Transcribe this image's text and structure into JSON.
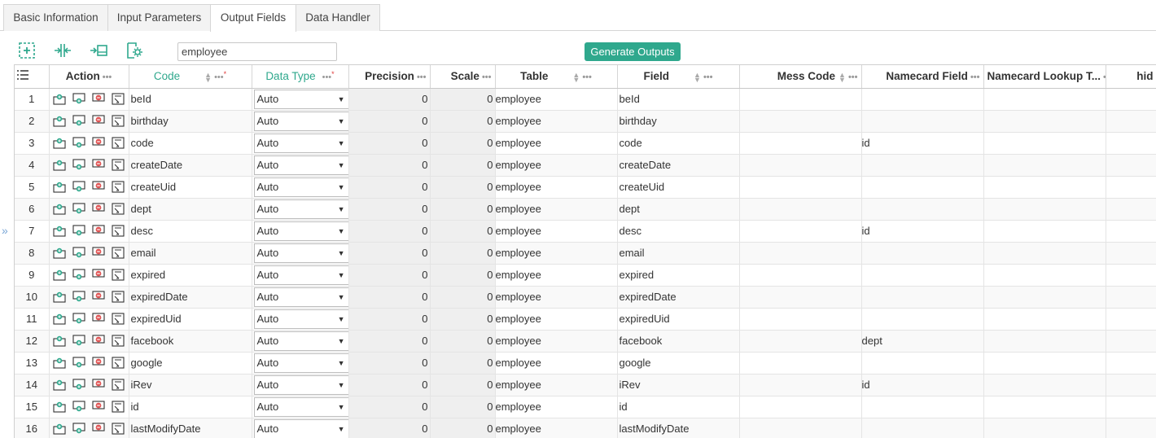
{
  "tabs": [
    {
      "label": "Basic Information"
    },
    {
      "label": "Input Parameters"
    },
    {
      "label": "Output Fields",
      "active": true
    },
    {
      "label": "Data Handler"
    }
  ],
  "toolbar": {
    "icons": [
      "add-frame-icon",
      "split-columns-icon",
      "import-icon",
      "settings-page-icon"
    ],
    "table_name_value": "employee",
    "generate_label": "Generate Outputs"
  },
  "colors": {
    "accent": "#2fa88d",
    "remove": "#e05555"
  },
  "grid": {
    "headers": {
      "action": "Action",
      "code": "Code",
      "data_type": "Data Type",
      "precision": "Precision",
      "scale": "Scale",
      "table": "Table",
      "field": "Field",
      "mess_code": "Mess Code",
      "namecard_field": "Namecard Field",
      "namecard_lookup": "Namecard Lookup T...",
      "hidden_partial": "hid"
    },
    "rows": [
      {
        "n": "1",
        "code": "beId",
        "type": "Auto",
        "precision": "0",
        "scale": "0",
        "table": "employee",
        "field": "beId",
        "namecard": ""
      },
      {
        "n": "2",
        "code": "birthday",
        "type": "Auto",
        "precision": "0",
        "scale": "0",
        "table": "employee",
        "field": "birthday",
        "namecard": ""
      },
      {
        "n": "3",
        "code": "code",
        "type": "Auto",
        "precision": "0",
        "scale": "0",
        "table": "employee",
        "field": "code",
        "namecard": "id"
      },
      {
        "n": "4",
        "code": "createDate",
        "type": "Auto",
        "precision": "0",
        "scale": "0",
        "table": "employee",
        "field": "createDate",
        "namecard": ""
      },
      {
        "n": "5",
        "code": "createUid",
        "type": "Auto",
        "precision": "0",
        "scale": "0",
        "table": "employee",
        "field": "createUid",
        "namecard": ""
      },
      {
        "n": "6",
        "code": "dept",
        "type": "Auto",
        "precision": "0",
        "scale": "0",
        "table": "employee",
        "field": "dept",
        "namecard": ""
      },
      {
        "n": "7",
        "code": "desc",
        "type": "Auto",
        "precision": "0",
        "scale": "0",
        "table": "employee",
        "field": "desc",
        "namecard": "id"
      },
      {
        "n": "8",
        "code": "email",
        "type": "Auto",
        "precision": "0",
        "scale": "0",
        "table": "employee",
        "field": "email",
        "namecard": ""
      },
      {
        "n": "9",
        "code": "expired",
        "type": "Auto",
        "precision": "0",
        "scale": "0",
        "table": "employee",
        "field": "expired",
        "namecard": ""
      },
      {
        "n": "10",
        "code": "expiredDate",
        "type": "Auto",
        "precision": "0",
        "scale": "0",
        "table": "employee",
        "field": "expiredDate",
        "namecard": ""
      },
      {
        "n": "11",
        "code": "expiredUid",
        "type": "Auto",
        "precision": "0",
        "scale": "0",
        "table": "employee",
        "field": "expiredUid",
        "namecard": ""
      },
      {
        "n": "12",
        "code": "facebook",
        "type": "Auto",
        "precision": "0",
        "scale": "0",
        "table": "employee",
        "field": "facebook",
        "namecard": "dept"
      },
      {
        "n": "13",
        "code": "google",
        "type": "Auto",
        "precision": "0",
        "scale": "0",
        "table": "employee",
        "field": "google",
        "namecard": ""
      },
      {
        "n": "14",
        "code": "iRev",
        "type": "Auto",
        "precision": "0",
        "scale": "0",
        "table": "employee",
        "field": "iRev",
        "namecard": "id"
      },
      {
        "n": "15",
        "code": "id",
        "type": "Auto",
        "precision": "0",
        "scale": "0",
        "table": "employee",
        "field": "id",
        "namecard": ""
      },
      {
        "n": "16",
        "code": "lastModifyDate",
        "type": "Auto",
        "precision": "0",
        "scale": "0",
        "table": "employee",
        "field": "lastModifyDate",
        "namecard": ""
      }
    ]
  },
  "sidebar": {
    "expand_glyph": "»"
  }
}
